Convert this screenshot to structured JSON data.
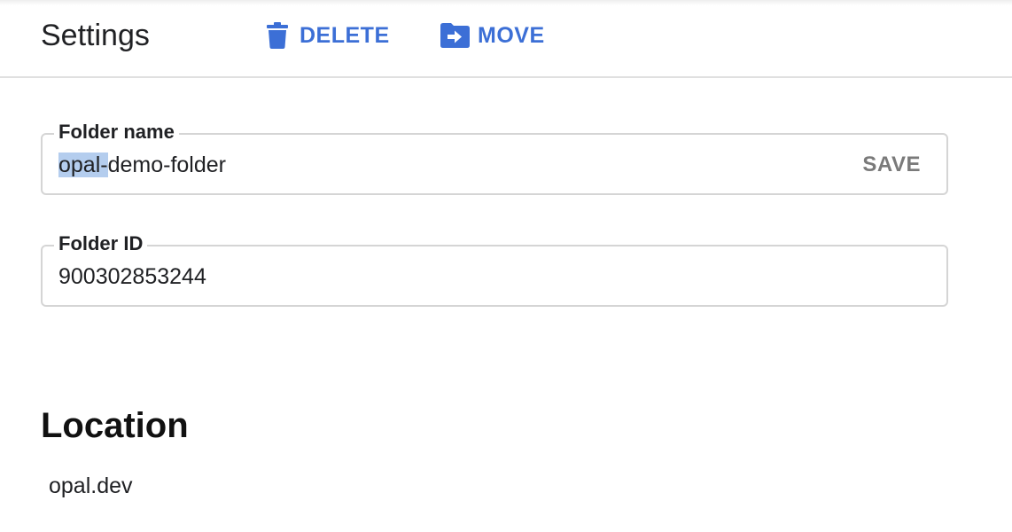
{
  "header": {
    "title": "Settings",
    "delete_label": "DELETE",
    "delete_icon": "trash-icon",
    "move_label": "MOVE",
    "move_icon": "folder-move-icon"
  },
  "colors": {
    "accent": "#3c6fd6",
    "selection": "#b4cdee",
    "border": "#d5d5d5",
    "save_text": "#7a7a7a"
  },
  "folder_name": {
    "label": "Folder name",
    "value_selected": "opal-",
    "value_rest": "demo-folder",
    "save_label": "SAVE"
  },
  "folder_id": {
    "label": "Folder ID",
    "value": "900302853244"
  },
  "location": {
    "title": "Location",
    "value": "opal.dev"
  }
}
